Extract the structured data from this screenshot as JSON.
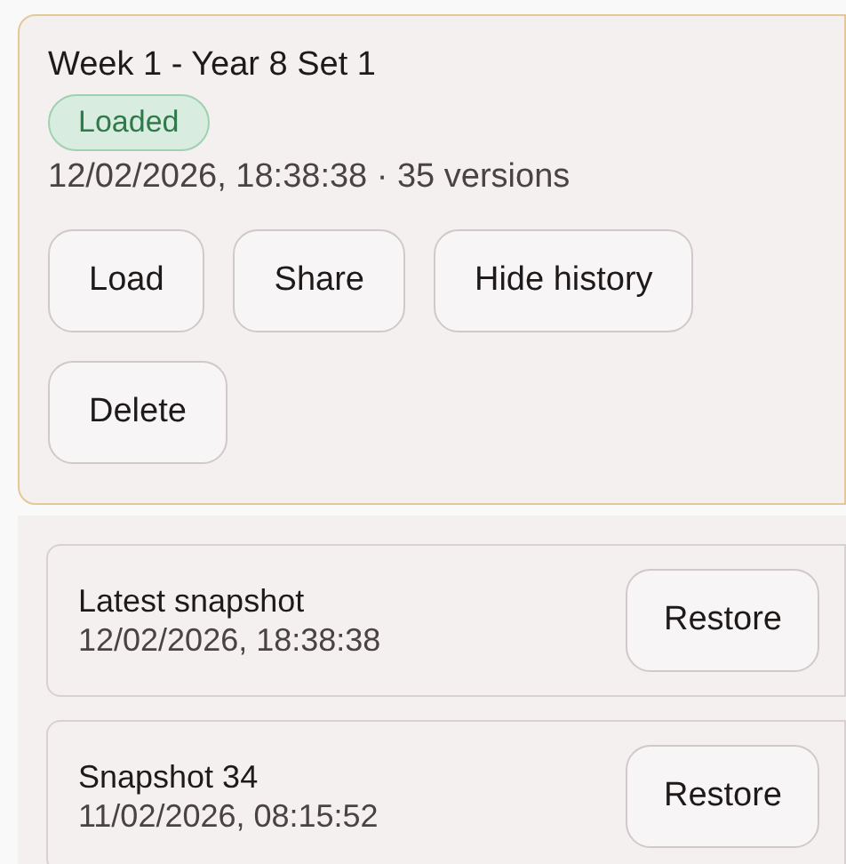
{
  "project": {
    "title": "Week 1 - Year 8 Set 1",
    "badge": "Loaded",
    "meta": "12/02/2026, 18:38:38 · 35 versions",
    "actions": [
      "Load",
      "Share",
      "Hide history",
      "Delete"
    ]
  },
  "snapshots": [
    {
      "name": "Latest snapshot",
      "time": "12/02/2026, 18:38:38",
      "action": "Restore"
    },
    {
      "name": "Snapshot 34",
      "time": "11/02/2026, 08:15:52",
      "action": "Restore"
    }
  ]
}
